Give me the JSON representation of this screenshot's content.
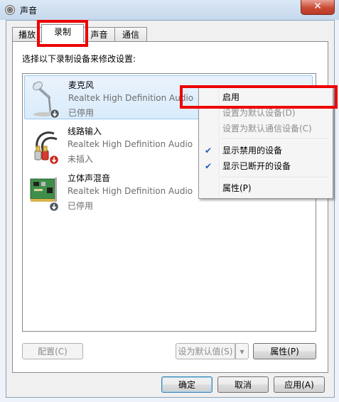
{
  "window": {
    "title": "声音",
    "close_glyph": "✕"
  },
  "tabs": [
    {
      "label": "播放",
      "active": false
    },
    {
      "label": "录制",
      "active": true
    },
    {
      "label": "声音",
      "active": false
    },
    {
      "label": "通信",
      "active": false
    }
  ],
  "panel_label": "选择以下录制设备来修改设置:",
  "devices": [
    {
      "name": "麦克风",
      "driver": "Realtek High Definition Audio",
      "status": "已停用",
      "icon": "microphone-icon",
      "badge": "down-arrow-badge"
    },
    {
      "name": "线路输入",
      "driver": "Realtek High Definition Audio",
      "status": "未插入",
      "icon": "line-in-cable-icon",
      "badge": "red-down-arrow-badge"
    },
    {
      "name": "立体声混音",
      "driver": "Realtek High Definition Audio",
      "status": "已停用",
      "icon": "sound-card-icon",
      "badge": "down-arrow-badge"
    }
  ],
  "context_menu": {
    "items": [
      {
        "label": "启用",
        "enabled": true,
        "checked": false
      },
      {
        "label": "设置为默认设备(D)",
        "enabled": false,
        "checked": false
      },
      {
        "label": "设置为默认通信设备(C)",
        "enabled": false,
        "checked": false
      },
      {
        "label": "显示禁用的设备",
        "enabled": true,
        "checked": true
      },
      {
        "label": "显示已断开的设备",
        "enabled": true,
        "checked": true
      },
      {
        "label": "属性(P)",
        "enabled": true,
        "checked": false
      }
    ]
  },
  "buttons": {
    "configure": "配置(C)",
    "set_default": "设为默认值(S)",
    "set_default_arrow": "▾",
    "properties": "属性(P)",
    "ok": "确定",
    "cancel": "取消",
    "apply": "应用(A)"
  },
  "colors": {
    "highlight": "#ee0000",
    "selection": "#d9ebfb",
    "check": "#1e5fb5"
  }
}
